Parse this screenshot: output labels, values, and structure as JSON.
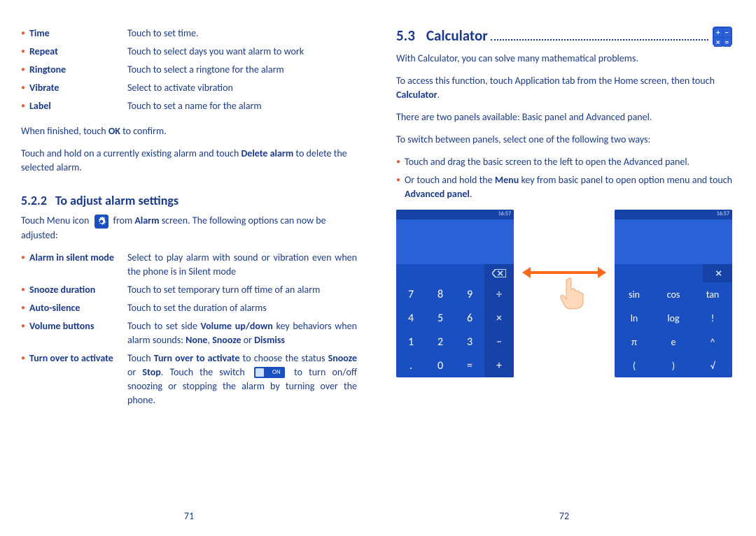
{
  "left": {
    "items1": [
      {
        "term": "Time",
        "desc": "Touch to set time."
      },
      {
        "term": "Repeat",
        "desc": "Touch to select days you want alarm to work"
      },
      {
        "term": "Ringtone",
        "desc": "Touch to select a ringtone for the alarm"
      },
      {
        "term": "Vibrate",
        "desc": "Select to activate vibration"
      },
      {
        "term": "Label",
        "desc": "Touch to set a name for the alarm"
      }
    ],
    "finish_pre": "When finished, touch ",
    "finish_b": "OK",
    "finish_post": " to confirm.",
    "delete_pre": "Touch and hold on a currently existing alarm and touch ",
    "delete_b": "Delete alarm",
    "delete_post": " to delete the selected alarm.",
    "h_num": "5.2.2",
    "h_title": "To adjust alarm settings",
    "menu_pre": "Touch Menu icon ",
    "menu_mid": " from ",
    "menu_b": "Alarm",
    "menu_post": " screen. The following options can now be adjusted:",
    "items2": [
      {
        "term": "Alarm in silent mode",
        "desc": "Select to play alarm with sound or vibration even when the phone is in Silent mode"
      },
      {
        "term": "Snooze duration",
        "desc": "Touch to set temporary turn off time of an alarm"
      },
      {
        "term": "Auto-silence",
        "desc": "Touch to set the duration of alarms"
      }
    ],
    "vol_term": "Volume buttons",
    "vol_pre": "Touch to set side ",
    "vol_b1": "Volume up/down",
    "vol_mid": " key behaviors when alarm sounds: ",
    "vol_b2": "None",
    "vol_sep": ", ",
    "vol_b3": "Snooze",
    "vol_or": " or ",
    "vol_b4": "Dismiss",
    "turn_term": "Turn over to activate",
    "turn_pre": "Touch ",
    "turn_b1": "Turn over to activate",
    "turn_mid1": " to choose the status ",
    "turn_b2": "Snooze",
    "turn_or": " or ",
    "turn_b3": "Stop",
    "turn_mid2": ". Touch the switch ",
    "switch_label": "ON",
    "turn_post": " to turn on/off snoozing or stopping the alarm by turning over the phone.",
    "page": "71"
  },
  "right": {
    "secnum": "5.3",
    "sectitle": "Calculator",
    "p1": "With Calculator, you can solve many mathematical problems.",
    "p2_pre": "To access this function, touch Application tab from the Home screen, then touch ",
    "p2_b": "Calculator",
    "p2_post": ".",
    "p3": "There are two panels available: Basic panel and Advanced panel.",
    "p4": "To switch between panels, select one of the following two ways:",
    "b1": "Touch and drag the basic screen to the left to open the Advanced panel.",
    "b2_pre": "Or touch and hold the ",
    "b2_b1": "Menu",
    "b2_mid": " key from basic panel to open option menu and touch ",
    "b2_b2": "Advanced panel",
    "b2_post": ".",
    "appicon": [
      "+",
      "−",
      "×",
      "="
    ],
    "status_l": "",
    "status_r": "16:57",
    "keys": [
      [
        "7",
        "8",
        "9",
        "÷"
      ],
      [
        "4",
        "5",
        "6",
        "×"
      ],
      [
        "1",
        "2",
        "3",
        "−"
      ],
      [
        ".",
        "0",
        "=",
        "+"
      ]
    ],
    "adv": [
      [
        "sin",
        "cos",
        "tan"
      ],
      [
        "ln",
        "log",
        "!"
      ],
      [
        "π",
        "e",
        "^"
      ],
      [
        "(",
        ")",
        "√"
      ]
    ],
    "page": "72"
  }
}
